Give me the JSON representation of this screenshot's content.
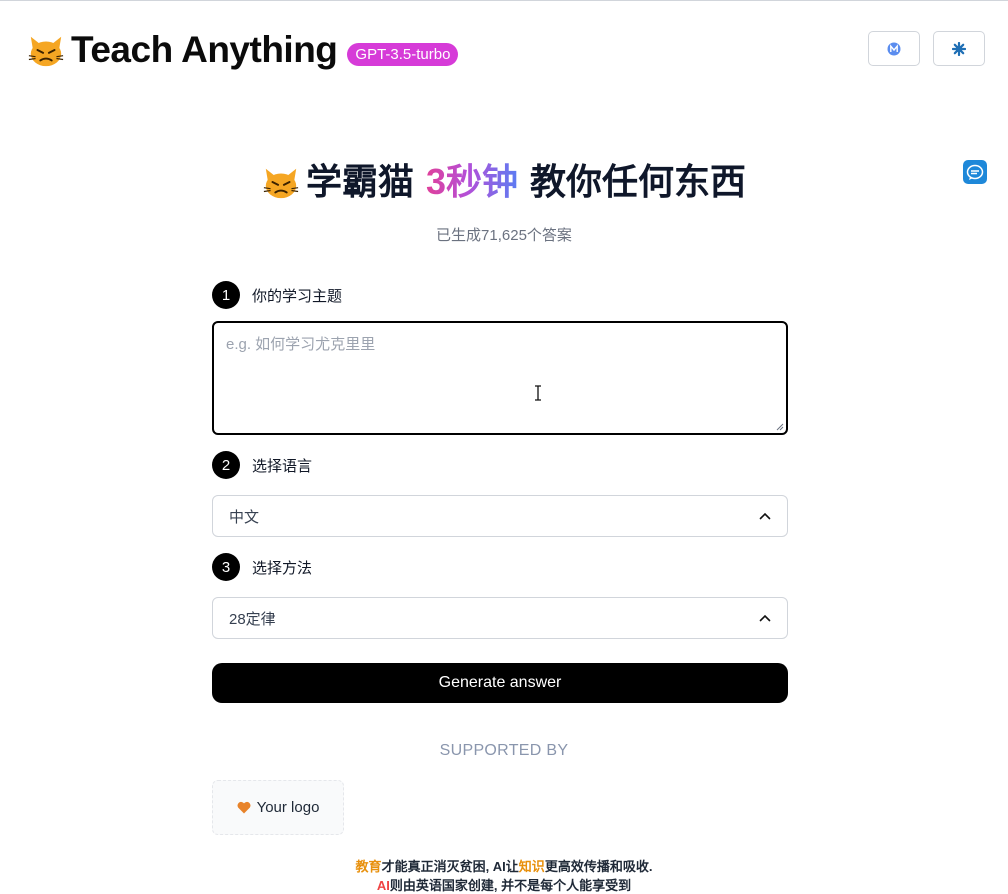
{
  "header": {
    "title": "Teach Anything",
    "model_badge": "GPT-3.5-turbo",
    "buttons": [
      {
        "icon": "m-logo-icon"
      },
      {
        "icon": "settings-icon"
      }
    ]
  },
  "hero": {
    "prefix": "学霸猫",
    "accent": "3秒钟",
    "suffix": "教你任何东西",
    "counter": "已生成71,625个答案"
  },
  "form": {
    "step1": {
      "number": "1",
      "label": "你的学习主题",
      "placeholder": "e.g. 如何学习尤克里里",
      "value": ""
    },
    "step2": {
      "number": "2",
      "label": "选择语言",
      "selected": "中文"
    },
    "step3": {
      "number": "3",
      "label": "选择方法",
      "selected": "28定律"
    },
    "generate_label": "Generate answer"
  },
  "sponsors": {
    "heading": "SUPPORTED BY",
    "logo_text": "Your logo"
  },
  "footer": {
    "line1": {
      "a": "教育",
      "b": "才能真正消灭贫困, AI让",
      "c": "知识",
      "d": "更高效传播和吸收."
    },
    "line2": {
      "a": "AI",
      "b": "则由英语国家创建, 并不是每个人能享受到"
    }
  },
  "colors": {
    "badge": "#d63bd8",
    "accent_gradient": [
      "#e0409a",
      "#b44fd8",
      "#5b7cf2"
    ],
    "button": "#000000",
    "highlight_orange": "#e8900c",
    "highlight_red": "#ef4444"
  }
}
